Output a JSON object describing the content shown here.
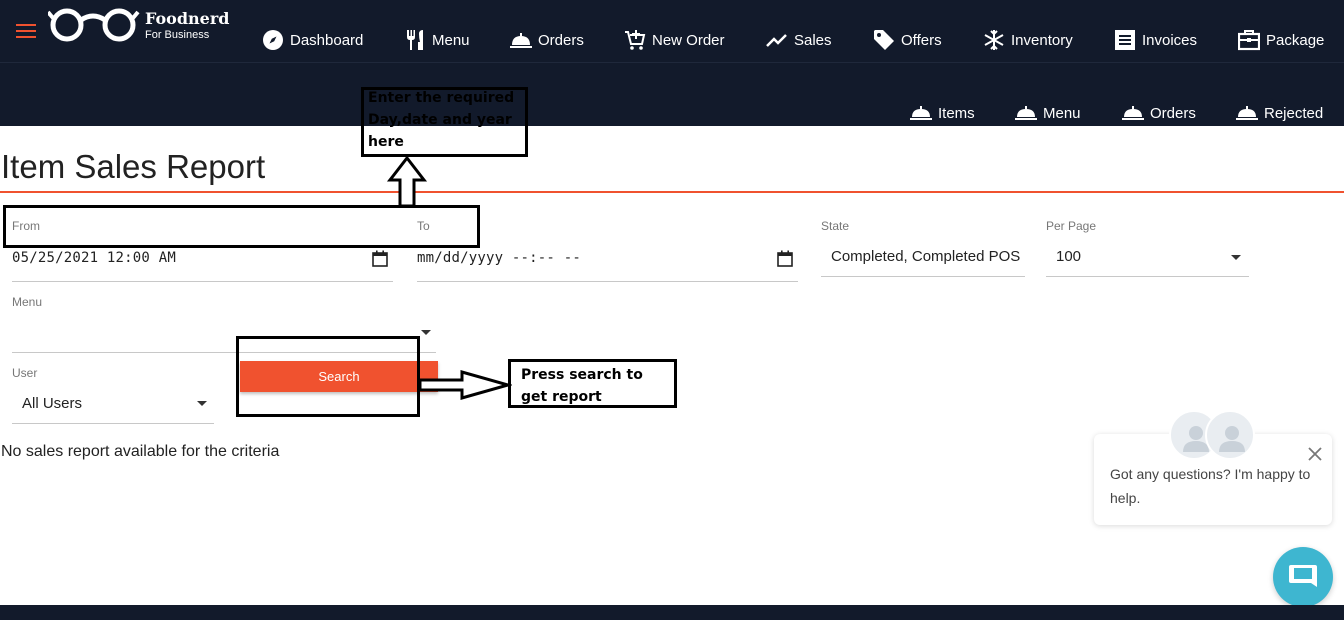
{
  "brand": {
    "name": "Foodnerd",
    "tagline": "For Business"
  },
  "nav": [
    {
      "label": "Dashboard",
      "icon": "compass-icon"
    },
    {
      "label": "Menu",
      "icon": "fork-knife-icon"
    },
    {
      "label": "Orders",
      "icon": "cloche-icon"
    },
    {
      "label": "New Order",
      "icon": "cart-plus-icon"
    },
    {
      "label": "Sales",
      "icon": "trend-up-icon"
    },
    {
      "label": "Offers",
      "icon": "tag-icon"
    },
    {
      "label": "Inventory",
      "icon": "snowflake-icon"
    },
    {
      "label": "Invoices",
      "icon": "invoice-icon"
    },
    {
      "label": "Package",
      "icon": "package-icon"
    }
  ],
  "subnav": [
    {
      "label": "Items",
      "icon": "cloche-icon"
    },
    {
      "label": "Menu",
      "icon": "cloche-icon"
    },
    {
      "label": "Orders",
      "icon": "cloche-icon"
    },
    {
      "label": "Rejected",
      "icon": "cloche-icon"
    }
  ],
  "page": {
    "title": "Item Sales Report"
  },
  "filters": {
    "from_label": "From",
    "from_value": "05/25/2021 12:00 AM",
    "to_label": "To",
    "to_value": "mm/dd/yyyy --:-- --",
    "state_label": "State",
    "state_value": "Completed, Completed POS",
    "per_page_label": "Per Page",
    "per_page_value": "100",
    "menu_label": "Menu",
    "menu_value": "",
    "user_label": "User",
    "user_value": "All Users",
    "search_label": "Search"
  },
  "empty_message": "No sales report available for the criteria",
  "annotations": {
    "date_note": [
      "Enter the required",
      "Day,date and year",
      "here"
    ],
    "search_note": [
      "Press search to",
      "get report"
    ]
  },
  "chat": {
    "message": "Got any questions? I'm happy to help.",
    "launcher_color": "#3eb6d0"
  },
  "colors": {
    "navbar": "#121a2b",
    "accent": "#f0522f"
  }
}
